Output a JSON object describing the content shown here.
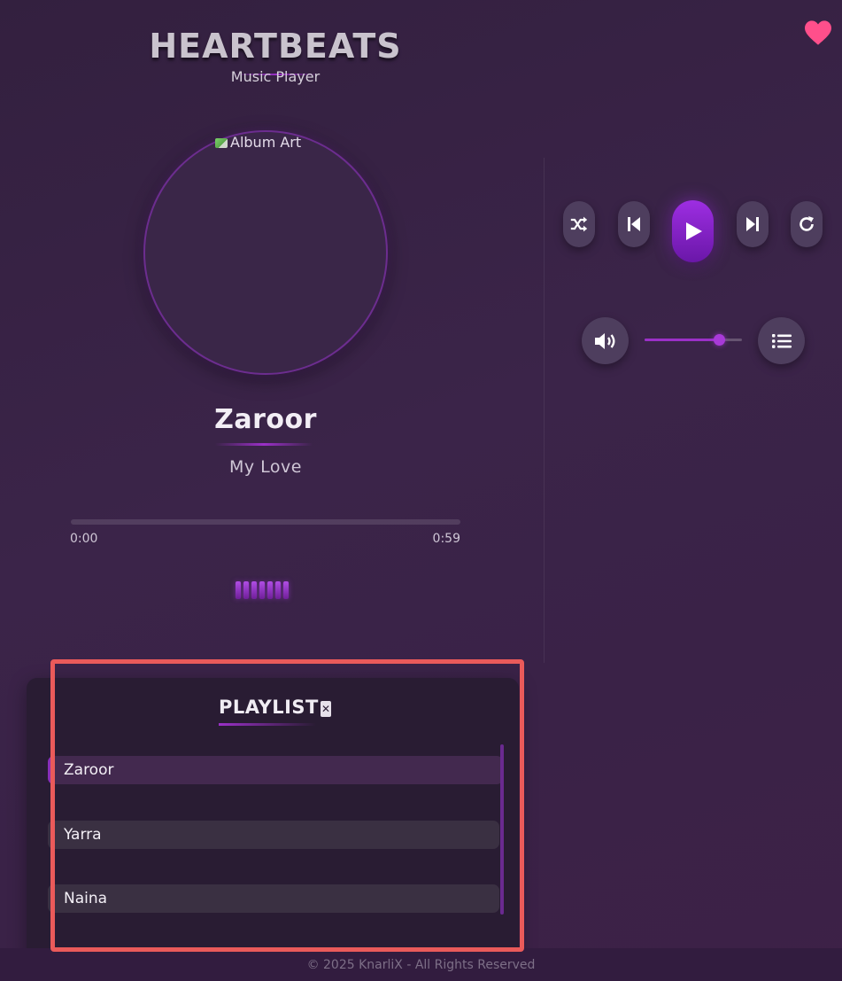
{
  "header": {
    "brand": "HEARTBEATS",
    "subtitle": "Music Player",
    "favorite_icon": "heart-icon"
  },
  "now_playing": {
    "album_art_alt": "Album Art",
    "title": "Zaroor",
    "artist": "My Love",
    "current_time": "0:00",
    "duration": "0:59",
    "progress_fraction": 0.0
  },
  "controls": {
    "shuffle_icon": "shuffle-icon",
    "previous_icon": "skip-previous-icon",
    "play_icon": "play-icon",
    "next_icon": "skip-next-icon",
    "repeat_icon": "repeat-icon",
    "volume_icon": "volume-icon",
    "playlist_icon": "list-icon",
    "volume_fraction": 0.76
  },
  "playlist": {
    "heading": "PLAYLIST",
    "close_glyph": "✕",
    "items": [
      {
        "label": "Zaroor",
        "active": true
      },
      {
        "label": "Yarra",
        "active": false
      },
      {
        "label": "Naina",
        "active": false
      }
    ]
  },
  "footer": {
    "text": "© 2025 KnarliX - All Rights Reserved"
  },
  "colors": {
    "accent": "#9b30c8",
    "favorite": "#ff4f8b",
    "highlight": "#ea5a5a"
  }
}
